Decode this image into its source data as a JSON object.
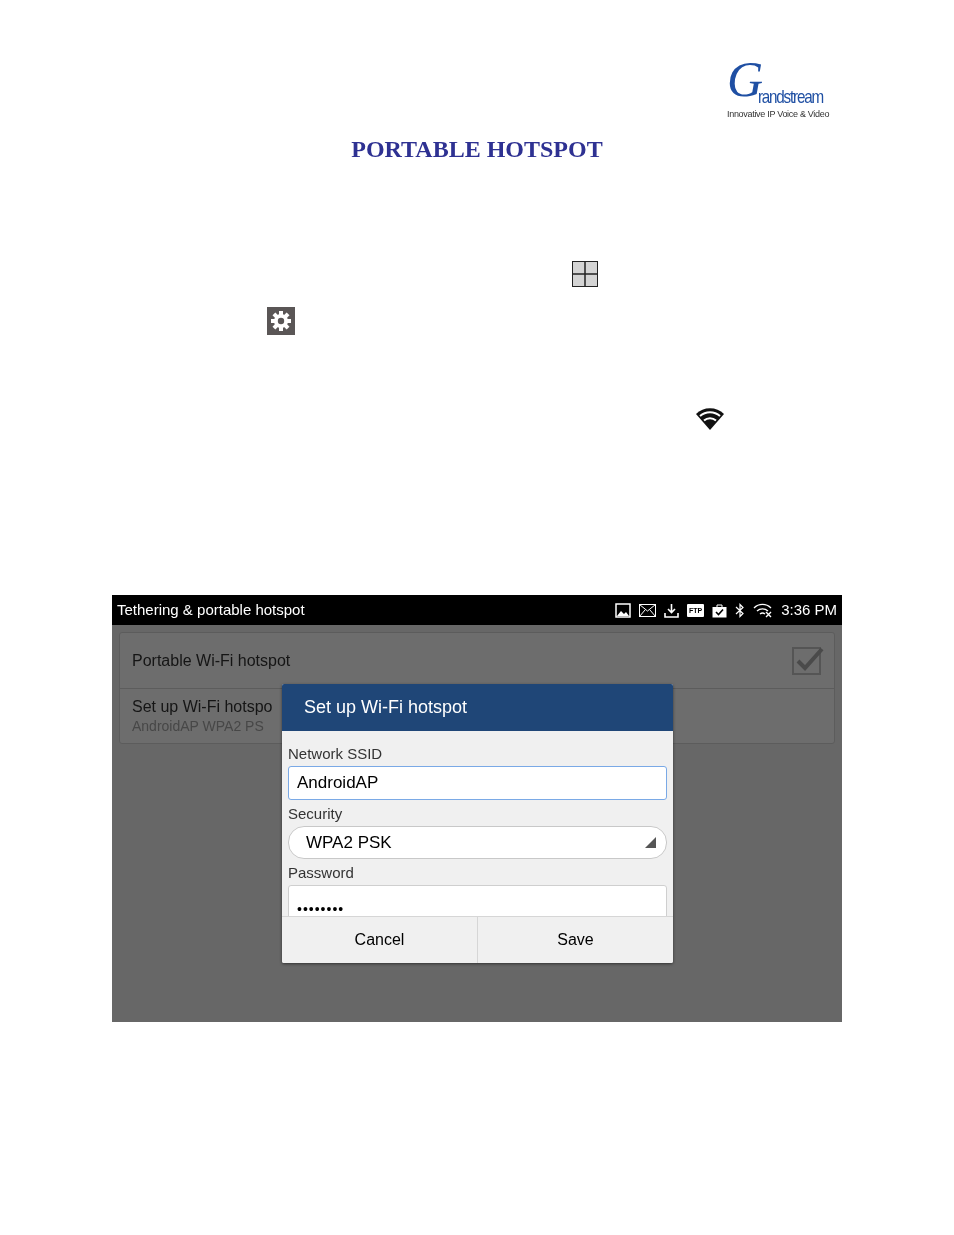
{
  "logo": {
    "letter": "G",
    "wordmark": "randstream",
    "tagline": "Innovative IP Voice & Video"
  },
  "title": "PORTABLE HOTSPOT",
  "screenshot": {
    "status_bar": {
      "title": "Tethering & portable hotspot",
      "ftp_badge": "FTP",
      "time": "3:36 PM"
    },
    "settings": [
      {
        "kind": "checkbox",
        "label": "Portable Wi-Fi hotspot",
        "checked": true
      },
      {
        "kind": "text",
        "label": "Set up Wi-Fi hotspo",
        "summary": "AndroidAP WPA2 PS"
      }
    ],
    "dialog": {
      "title": "Set up Wi-Fi hotspot",
      "fields": [
        {
          "kind": "text",
          "label": "Network SSID",
          "value": "AndroidAP",
          "focused": true
        },
        {
          "kind": "select",
          "label": "Security",
          "value": "WPA2 PSK"
        },
        {
          "kind": "password",
          "label": "Password",
          "value": "••••••••"
        }
      ],
      "buttons": [
        "Cancel",
        "Save"
      ]
    }
  }
}
